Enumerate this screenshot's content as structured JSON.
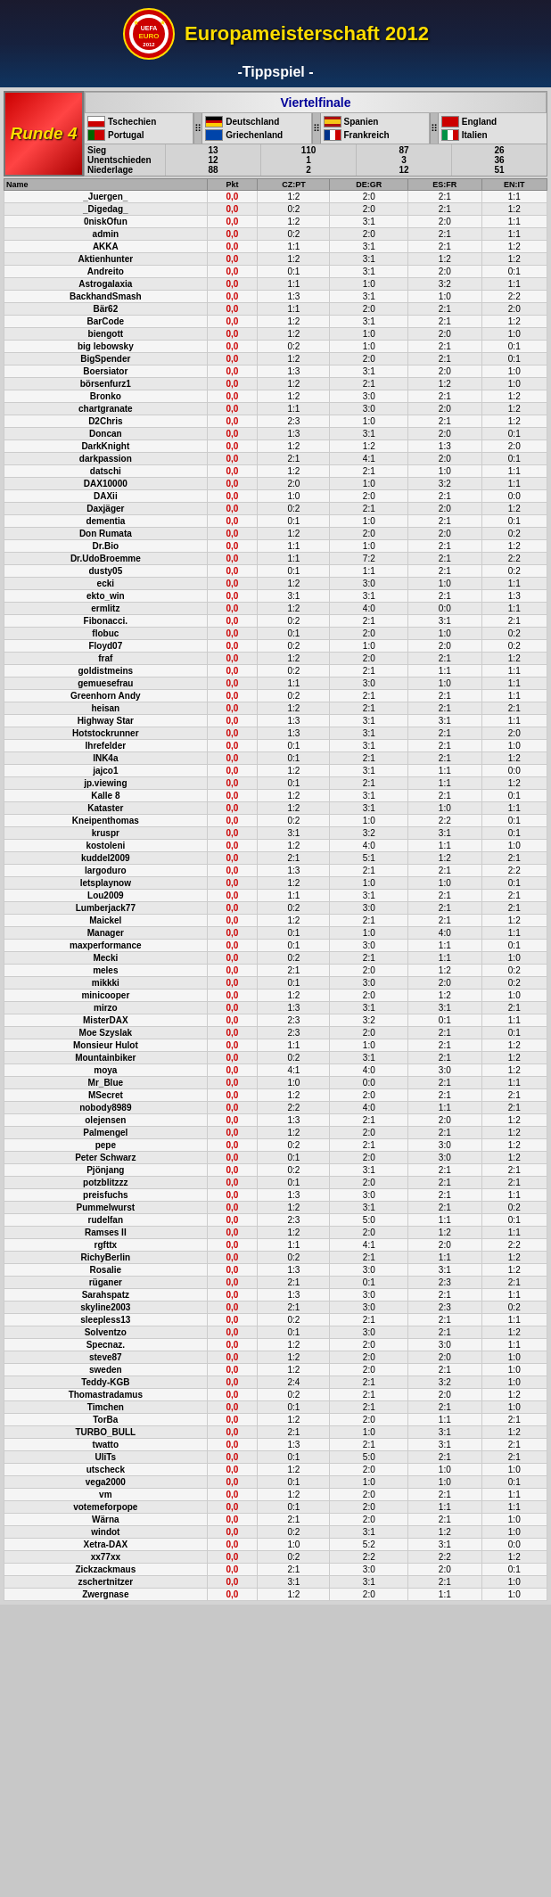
{
  "header": {
    "title": "Europameisterschaft 2012",
    "subtitle": "-Tippspiel -",
    "logo_text": "EURO 2012"
  },
  "round": {
    "label": "Runde 4"
  },
  "section_title": "Viertelfinale",
  "matches": [
    {
      "team1": "Tschechien",
      "team2": "Portugal",
      "flag1": "cz",
      "flag2": "pt"
    },
    {
      "team1": "Deutschland",
      "team2": "Griechenland",
      "flag1": "de",
      "flag2": "gr"
    },
    {
      "team1": "Spanien",
      "team2": "Frankreich",
      "flag1": "es",
      "flag2": "fr"
    },
    {
      "team1": "England",
      "team2": "Italien",
      "flag1": "en",
      "flag2": "it"
    }
  ],
  "stats": {
    "labels": [
      "Sieg",
      "Unentschieden",
      "Niederlage"
    ],
    "values": [
      [
        "13",
        "12",
        "88"
      ],
      [
        "110",
        "1",
        "2"
      ],
      [
        "87",
        "3",
        "12"
      ],
      [
        "26",
        "36",
        "51"
      ]
    ]
  },
  "players": [
    {
      "name": "_Juergen_",
      "pts": "0,0",
      "s1": "1:2",
      "s2": "2:0",
      "s3": "2:1",
      "s4": "1:1"
    },
    {
      "name": "_Digedag_",
      "pts": "0,0",
      "s1": "0:2",
      "s2": "2:0",
      "s3": "2:1",
      "s4": "1:2"
    },
    {
      "name": "0niskOfun",
      "pts": "0,0",
      "s1": "1:2",
      "s2": "3:1",
      "s3": "2:0",
      "s4": "1:1"
    },
    {
      "name": "admin",
      "pts": "0,0",
      "s1": "0:2",
      "s2": "2:0",
      "s3": "2:1",
      "s4": "1:1"
    },
    {
      "name": "AKKA",
      "pts": "0,0",
      "s1": "1:1",
      "s2": "3:1",
      "s3": "2:1",
      "s4": "1:2"
    },
    {
      "name": "Aktienhunter",
      "pts": "0,0",
      "s1": "1:2",
      "s2": "3:1",
      "s3": "1:2",
      "s4": "1:2"
    },
    {
      "name": "Andreito",
      "pts": "0,0",
      "s1": "0:1",
      "s2": "3:1",
      "s3": "2:0",
      "s4": "0:1"
    },
    {
      "name": "Astrogalaxia",
      "pts": "0,0",
      "s1": "1:1",
      "s2": "1:0",
      "s3": "3:2",
      "s4": "1:1"
    },
    {
      "name": "BackhandSmash",
      "pts": "0,0",
      "s1": "1:3",
      "s2": "3:1",
      "s3": "1:0",
      "s4": "2:2"
    },
    {
      "name": "Bär62",
      "pts": "0,0",
      "s1": "1:1",
      "s2": "2:0",
      "s3": "2:1",
      "s4": "2:0"
    },
    {
      "name": "BarCode",
      "pts": "0,0",
      "s1": "1:2",
      "s2": "3:1",
      "s3": "2:1",
      "s4": "1:2"
    },
    {
      "name": "biengott",
      "pts": "0,0",
      "s1": "1:2",
      "s2": "1:0",
      "s3": "2:0",
      "s4": "1:0"
    },
    {
      "name": "big lebowsky",
      "pts": "0,0",
      "s1": "0:2",
      "s2": "1:0",
      "s3": "2:1",
      "s4": "0:1"
    },
    {
      "name": "BigSpender",
      "pts": "0,0",
      "s1": "1:2",
      "s2": "2:0",
      "s3": "2:1",
      "s4": "0:1"
    },
    {
      "name": "Boersiator",
      "pts": "0,0",
      "s1": "1:3",
      "s2": "3:1",
      "s3": "2:0",
      "s4": "1:0"
    },
    {
      "name": "börsenfurz1",
      "pts": "0,0",
      "s1": "1:2",
      "s2": "2:1",
      "s3": "1:2",
      "s4": "1:0"
    },
    {
      "name": "Bronko",
      "pts": "0,0",
      "s1": "1:2",
      "s2": "3:0",
      "s3": "2:1",
      "s4": "1:2"
    },
    {
      "name": "chartgranate",
      "pts": "0,0",
      "s1": "1:1",
      "s2": "3:0",
      "s3": "2:0",
      "s4": "1:2"
    },
    {
      "name": "D2Chris",
      "pts": "0,0",
      "s1": "2:3",
      "s2": "1:0",
      "s3": "2:1",
      "s4": "1:2"
    },
    {
      "name": "Doncan",
      "pts": "0,0",
      "s1": "1:3",
      "s2": "3:1",
      "s3": "2:0",
      "s4": "0:1"
    },
    {
      "name": "DarkKnight",
      "pts": "0,0",
      "s1": "1:2",
      "s2": "1:2",
      "s3": "1:3",
      "s4": "2:0"
    },
    {
      "name": "darkpassion",
      "pts": "0,0",
      "s1": "2:1",
      "s2": "4:1",
      "s3": "2:0",
      "s4": "0:1"
    },
    {
      "name": "datschi",
      "pts": "0,0",
      "s1": "1:2",
      "s2": "2:1",
      "s3": "1:0",
      "s4": "1:1"
    },
    {
      "name": "DAX10000",
      "pts": "0,0",
      "s1": "2:0",
      "s2": "1:0",
      "s3": "3:2",
      "s4": "1:1"
    },
    {
      "name": "DAXii",
      "pts": "0,0",
      "s1": "1:0",
      "s2": "2:0",
      "s3": "2:1",
      "s4": "0:0"
    },
    {
      "name": "Daxjäger",
      "pts": "0,0",
      "s1": "0:2",
      "s2": "2:1",
      "s3": "2:0",
      "s4": "1:2"
    },
    {
      "name": "dementia",
      "pts": "0,0",
      "s1": "0:1",
      "s2": "1:0",
      "s3": "2:1",
      "s4": "0:1"
    },
    {
      "name": "Don Rumata",
      "pts": "0,0",
      "s1": "1:2",
      "s2": "2:0",
      "s3": "2:0",
      "s4": "0:2"
    },
    {
      "name": "Dr.Bio",
      "pts": "0,0",
      "s1": "1:1",
      "s2": "1:0",
      "s3": "2:1",
      "s4": "1:2"
    },
    {
      "name": "Dr.UdoBroemme",
      "pts": "0,0",
      "s1": "1:1",
      "s2": "7:2",
      "s3": "2:1",
      "s4": "2:2"
    },
    {
      "name": "dusty05",
      "pts": "0,0",
      "s1": "0:1",
      "s2": "1:1",
      "s3": "2:1",
      "s4": "0:2"
    },
    {
      "name": "ecki",
      "pts": "0,0",
      "s1": "1:2",
      "s2": "3:0",
      "s3": "1:0",
      "s4": "1:1"
    },
    {
      "name": "ekto_win",
      "pts": "0,0",
      "s1": "3:1",
      "s2": "3:1",
      "s3": "2:1",
      "s4": "1:3"
    },
    {
      "name": "ermlitz",
      "pts": "0,0",
      "s1": "1:2",
      "s2": "4:0",
      "s3": "0:0",
      "s4": "1:1"
    },
    {
      "name": "Fibonacci.",
      "pts": "0,0",
      "s1": "0:2",
      "s2": "2:1",
      "s3": "3:1",
      "s4": "2:1"
    },
    {
      "name": "flobuc",
      "pts": "0,0",
      "s1": "0:1",
      "s2": "2:0",
      "s3": "1:0",
      "s4": "0:2"
    },
    {
      "name": "Floyd07",
      "pts": "0,0",
      "s1": "0:2",
      "s2": "1:0",
      "s3": "2:0",
      "s4": "0:2"
    },
    {
      "name": "fraf",
      "pts": "0,0",
      "s1": "1:2",
      "s2": "2:0",
      "s3": "2:1",
      "s4": "1:2"
    },
    {
      "name": "goldistmeins",
      "pts": "0,0",
      "s1": "0:2",
      "s2": "2:1",
      "s3": "1:1",
      "s4": "1:1"
    },
    {
      "name": "gemuesefrau",
      "pts": "0,0",
      "s1": "1:1",
      "s2": "3:0",
      "s3": "1:0",
      "s4": "1:1"
    },
    {
      "name": "Greenhorn Andy",
      "pts": "0,0",
      "s1": "0:2",
      "s2": "2:1",
      "s3": "2:1",
      "s4": "1:1"
    },
    {
      "name": "heisan",
      "pts": "0,0",
      "s1": "1:2",
      "s2": "2:1",
      "s3": "2:1",
      "s4": "2:1"
    },
    {
      "name": "Highway Star",
      "pts": "0,0",
      "s1": "1:3",
      "s2": "3:1",
      "s3": "3:1",
      "s4": "1:1"
    },
    {
      "name": "Hotstockrunner",
      "pts": "0,0",
      "s1": "1:3",
      "s2": "3:1",
      "s3": "2:1",
      "s4": "2:0"
    },
    {
      "name": "Ihrefelder",
      "pts": "0,0",
      "s1": "0:1",
      "s2": "3:1",
      "s3": "2:1",
      "s4": "1:0"
    },
    {
      "name": "INK4a",
      "pts": "0,0",
      "s1": "0:1",
      "s2": "2:1",
      "s3": "2:1",
      "s4": "1:2"
    },
    {
      "name": "jajco1",
      "pts": "0,0",
      "s1": "1:2",
      "s2": "3:1",
      "s3": "1:1",
      "s4": "0:0"
    },
    {
      "name": "jp.viewing",
      "pts": "0,0",
      "s1": "0:1",
      "s2": "2:1",
      "s3": "1:1",
      "s4": "1:2"
    },
    {
      "name": "Kalle 8",
      "pts": "0,0",
      "s1": "1:2",
      "s2": "3:1",
      "s3": "2:1",
      "s4": "0:1"
    },
    {
      "name": "Kataster",
      "pts": "0,0",
      "s1": "1:2",
      "s2": "3:1",
      "s3": "1:0",
      "s4": "1:1"
    },
    {
      "name": "Kneipenthomas",
      "pts": "0,0",
      "s1": "0:2",
      "s2": "1:0",
      "s3": "2:2",
      "s4": "0:1"
    },
    {
      "name": "kruspr",
      "pts": "0,0",
      "s1": "3:1",
      "s2": "3:2",
      "s3": "3:1",
      "s4": "0:1"
    },
    {
      "name": "kostoleni",
      "pts": "0,0",
      "s1": "1:2",
      "s2": "4:0",
      "s3": "1:1",
      "s4": "1:0"
    },
    {
      "name": "kuddel2009",
      "pts": "0,0",
      "s1": "2:1",
      "s2": "5:1",
      "s3": "1:2",
      "s4": "2:1"
    },
    {
      "name": "largoduro",
      "pts": "0,0",
      "s1": "1:3",
      "s2": "2:1",
      "s3": "2:1",
      "s4": "2:2"
    },
    {
      "name": "letsplaynow",
      "pts": "0,0",
      "s1": "1:2",
      "s2": "1:0",
      "s3": "1:0",
      "s4": "0:1"
    },
    {
      "name": "Lou2009",
      "pts": "0,0",
      "s1": "1:1",
      "s2": "3:1",
      "s3": "2:1",
      "s4": "2:1"
    },
    {
      "name": "Lumberjack77",
      "pts": "0,0",
      "s1": "0:2",
      "s2": "3:0",
      "s3": "2:1",
      "s4": "2:1"
    },
    {
      "name": "Maickel",
      "pts": "0,0",
      "s1": "1:2",
      "s2": "2:1",
      "s3": "2:1",
      "s4": "1:2"
    },
    {
      "name": "Manager",
      "pts": "0,0",
      "s1": "0:1",
      "s2": "1:0",
      "s3": "4:0",
      "s4": "1:1"
    },
    {
      "name": "maxperformance",
      "pts": "0,0",
      "s1": "0:1",
      "s2": "3:0",
      "s3": "1:1",
      "s4": "0:1"
    },
    {
      "name": "Mecki",
      "pts": "0,0",
      "s1": "0:2",
      "s2": "2:1",
      "s3": "1:1",
      "s4": "1:0"
    },
    {
      "name": "meles",
      "pts": "0,0",
      "s1": "2:1",
      "s2": "2:0",
      "s3": "1:2",
      "s4": "0:2"
    },
    {
      "name": "mikkki",
      "pts": "0,0",
      "s1": "0:1",
      "s2": "3:0",
      "s3": "2:0",
      "s4": "0:2"
    },
    {
      "name": "minicooper",
      "pts": "0,0",
      "s1": "1:2",
      "s2": "2:0",
      "s3": "1:2",
      "s4": "1:0"
    },
    {
      "name": "mirzo",
      "pts": "0,0",
      "s1": "1:3",
      "s2": "3:1",
      "s3": "3:1",
      "s4": "2:1"
    },
    {
      "name": "MisterDAX",
      "pts": "0,0",
      "s1": "2:3",
      "s2": "3:2",
      "s3": "0:1",
      "s4": "1:1"
    },
    {
      "name": "Moe Szyslak",
      "pts": "0,0",
      "s1": "2:3",
      "s2": "2:0",
      "s3": "2:1",
      "s4": "0:1"
    },
    {
      "name": "Monsieur Hulot",
      "pts": "0,0",
      "s1": "1:1",
      "s2": "1:0",
      "s3": "2:1",
      "s4": "1:2"
    },
    {
      "name": "Mountainbiker",
      "pts": "0,0",
      "s1": "0:2",
      "s2": "3:1",
      "s3": "2:1",
      "s4": "1:2"
    },
    {
      "name": "moya",
      "pts": "0,0",
      "s1": "4:1",
      "s2": "4:0",
      "s3": "3:0",
      "s4": "1:2"
    },
    {
      "name": "Mr_Blue",
      "pts": "0,0",
      "s1": "1:0",
      "s2": "0:0",
      "s3": "2:1",
      "s4": "1:1"
    },
    {
      "name": "MSecret",
      "pts": "0,0",
      "s1": "1:2",
      "s2": "2:0",
      "s3": "2:1",
      "s4": "2:1"
    },
    {
      "name": "nobody8989",
      "pts": "0,0",
      "s1": "2:2",
      "s2": "4:0",
      "s3": "1:1",
      "s4": "2:1"
    },
    {
      "name": "olejensen",
      "pts": "0,0",
      "s1": "1:3",
      "s2": "2:1",
      "s3": "2:0",
      "s4": "1:2"
    },
    {
      "name": "Palmengel",
      "pts": "0,0",
      "s1": "1:2",
      "s2": "2:0",
      "s3": "2:1",
      "s4": "1:2"
    },
    {
      "name": "pepe",
      "pts": "0,0",
      "s1": "0:2",
      "s2": "2:1",
      "s3": "3:0",
      "s4": "1:2"
    },
    {
      "name": "Peter Schwarz",
      "pts": "0,0",
      "s1": "0:1",
      "s2": "2:0",
      "s3": "3:0",
      "s4": "1:2"
    },
    {
      "name": "Pjönjang",
      "pts": "0,0",
      "s1": "0:2",
      "s2": "3:1",
      "s3": "2:1",
      "s4": "2:1"
    },
    {
      "name": "potzblitzzz",
      "pts": "0,0",
      "s1": "0:1",
      "s2": "2:0",
      "s3": "2:1",
      "s4": "2:1"
    },
    {
      "name": "preisfuchs",
      "pts": "0,0",
      "s1": "1:3",
      "s2": "3:0",
      "s3": "2:1",
      "s4": "1:1"
    },
    {
      "name": "Pummelwurst",
      "pts": "0,0",
      "s1": "1:2",
      "s2": "3:1",
      "s3": "2:1",
      "s4": "0:2"
    },
    {
      "name": "rudelfan",
      "pts": "0,0",
      "s1": "2:3",
      "s2": "5:0",
      "s3": "1:1",
      "s4": "0:1"
    },
    {
      "name": "Ramses II",
      "pts": "0,0",
      "s1": "1:2",
      "s2": "2:0",
      "s3": "1:2",
      "s4": "1:1"
    },
    {
      "name": "rgfttx",
      "pts": "0,0",
      "s1": "1:1",
      "s2": "4:1",
      "s3": "2:0",
      "s4": "2:2"
    },
    {
      "name": "RichyBerlin",
      "pts": "0,0",
      "s1": "0:2",
      "s2": "2:1",
      "s3": "1:1",
      "s4": "1:2"
    },
    {
      "name": "Rosalie",
      "pts": "0,0",
      "s1": "1:3",
      "s2": "3:0",
      "s3": "3:1",
      "s4": "1:2"
    },
    {
      "name": "rüganer",
      "pts": "0,0",
      "s1": "2:1",
      "s2": "0:1",
      "s3": "2:3",
      "s4": "2:1"
    },
    {
      "name": "Sarahspatz",
      "pts": "0,0",
      "s1": "1:3",
      "s2": "3:0",
      "s3": "2:1",
      "s4": "1:1"
    },
    {
      "name": "skyline2003",
      "pts": "0,0",
      "s1": "2:1",
      "s2": "3:0",
      "s3": "2:3",
      "s4": "0:2"
    },
    {
      "name": "sleepless13",
      "pts": "0,0",
      "s1": "0:2",
      "s2": "2:1",
      "s3": "2:1",
      "s4": "1:1"
    },
    {
      "name": "Solventzo",
      "pts": "0,0",
      "s1": "0:1",
      "s2": "3:0",
      "s3": "2:1",
      "s4": "1:2"
    },
    {
      "name": "Specnaz.",
      "pts": "0,0",
      "s1": "1:2",
      "s2": "2:0",
      "s3": "3:0",
      "s4": "1:1"
    },
    {
      "name": "steve87",
      "pts": "0,0",
      "s1": "1:2",
      "s2": "2:0",
      "s3": "2:0",
      "s4": "1:0"
    },
    {
      "name": "sweden",
      "pts": "0,0",
      "s1": "1:2",
      "s2": "2:0",
      "s3": "2:1",
      "s4": "1:0"
    },
    {
      "name": "Teddy-KGB",
      "pts": "0,0",
      "s1": "2:4",
      "s2": "2:1",
      "s3": "3:2",
      "s4": "1:0"
    },
    {
      "name": "Thomastradamus",
      "pts": "0,0",
      "s1": "0:2",
      "s2": "2:1",
      "s3": "2:0",
      "s4": "1:2"
    },
    {
      "name": "Timchen",
      "pts": "0,0",
      "s1": "0:1",
      "s2": "2:1",
      "s3": "2:1",
      "s4": "1:0"
    },
    {
      "name": "TorBa",
      "pts": "0,0",
      "s1": "1:2",
      "s2": "2:0",
      "s3": "1:1",
      "s4": "2:1"
    },
    {
      "name": "TURBO_BULL",
      "pts": "0,0",
      "s1": "2:1",
      "s2": "1:0",
      "s3": "3:1",
      "s4": "1:2"
    },
    {
      "name": "twatto",
      "pts": "0,0",
      "s1": "1:3",
      "s2": "2:1",
      "s3": "3:1",
      "s4": "2:1"
    },
    {
      "name": "UliTs",
      "pts": "0,0",
      "s1": "0:1",
      "s2": "5:0",
      "s3": "2:1",
      "s4": "2:1"
    },
    {
      "name": "utscheck",
      "pts": "0,0",
      "s1": "1:2",
      "s2": "2:0",
      "s3": "1:0",
      "s4": "1:0"
    },
    {
      "name": "vega2000",
      "pts": "0,0",
      "s1": "0:1",
      "s2": "1:0",
      "s3": "1:0",
      "s4": "0:1"
    },
    {
      "name": "vm",
      "pts": "0,0",
      "s1": "1:2",
      "s2": "2:0",
      "s3": "2:1",
      "s4": "1:1"
    },
    {
      "name": "votemeforpope",
      "pts": "0,0",
      "s1": "0:1",
      "s2": "2:0",
      "s3": "1:1",
      "s4": "1:1"
    },
    {
      "name": "Wärna",
      "pts": "0,0",
      "s1": "2:1",
      "s2": "2:0",
      "s3": "2:1",
      "s4": "1:0"
    },
    {
      "name": "windot",
      "pts": "0,0",
      "s1": "0:2",
      "s2": "3:1",
      "s3": "1:2",
      "s4": "1:0"
    },
    {
      "name": "Xetra-DAX",
      "pts": "0,0",
      "s1": "1:0",
      "s2": "5:2",
      "s3": "3:1",
      "s4": "0:0"
    },
    {
      "name": "xx77xx",
      "pts": "0,0",
      "s1": "0:2",
      "s2": "2:2",
      "s3": "2:2",
      "s4": "1:2"
    },
    {
      "name": "Zickzackmaus",
      "pts": "0,0",
      "s1": "2:1",
      "s2": "3:0",
      "s3": "2:0",
      "s4": "0:1"
    },
    {
      "name": "zschertnitzer",
      "pts": "0,0",
      "s1": "3:1",
      "s2": "3:1",
      "s3": "2:1",
      "s4": "1:0"
    },
    {
      "name": "Zwergnase",
      "pts": "0,0",
      "s1": "1:2",
      "s2": "2:0",
      "s3": "1:1",
      "s4": "1:0"
    }
  ],
  "colors": {
    "accent": "#ffdd00",
    "red": "#cc0000",
    "dark_blue": "#000080",
    "header_bg": "#1a1a2e"
  }
}
